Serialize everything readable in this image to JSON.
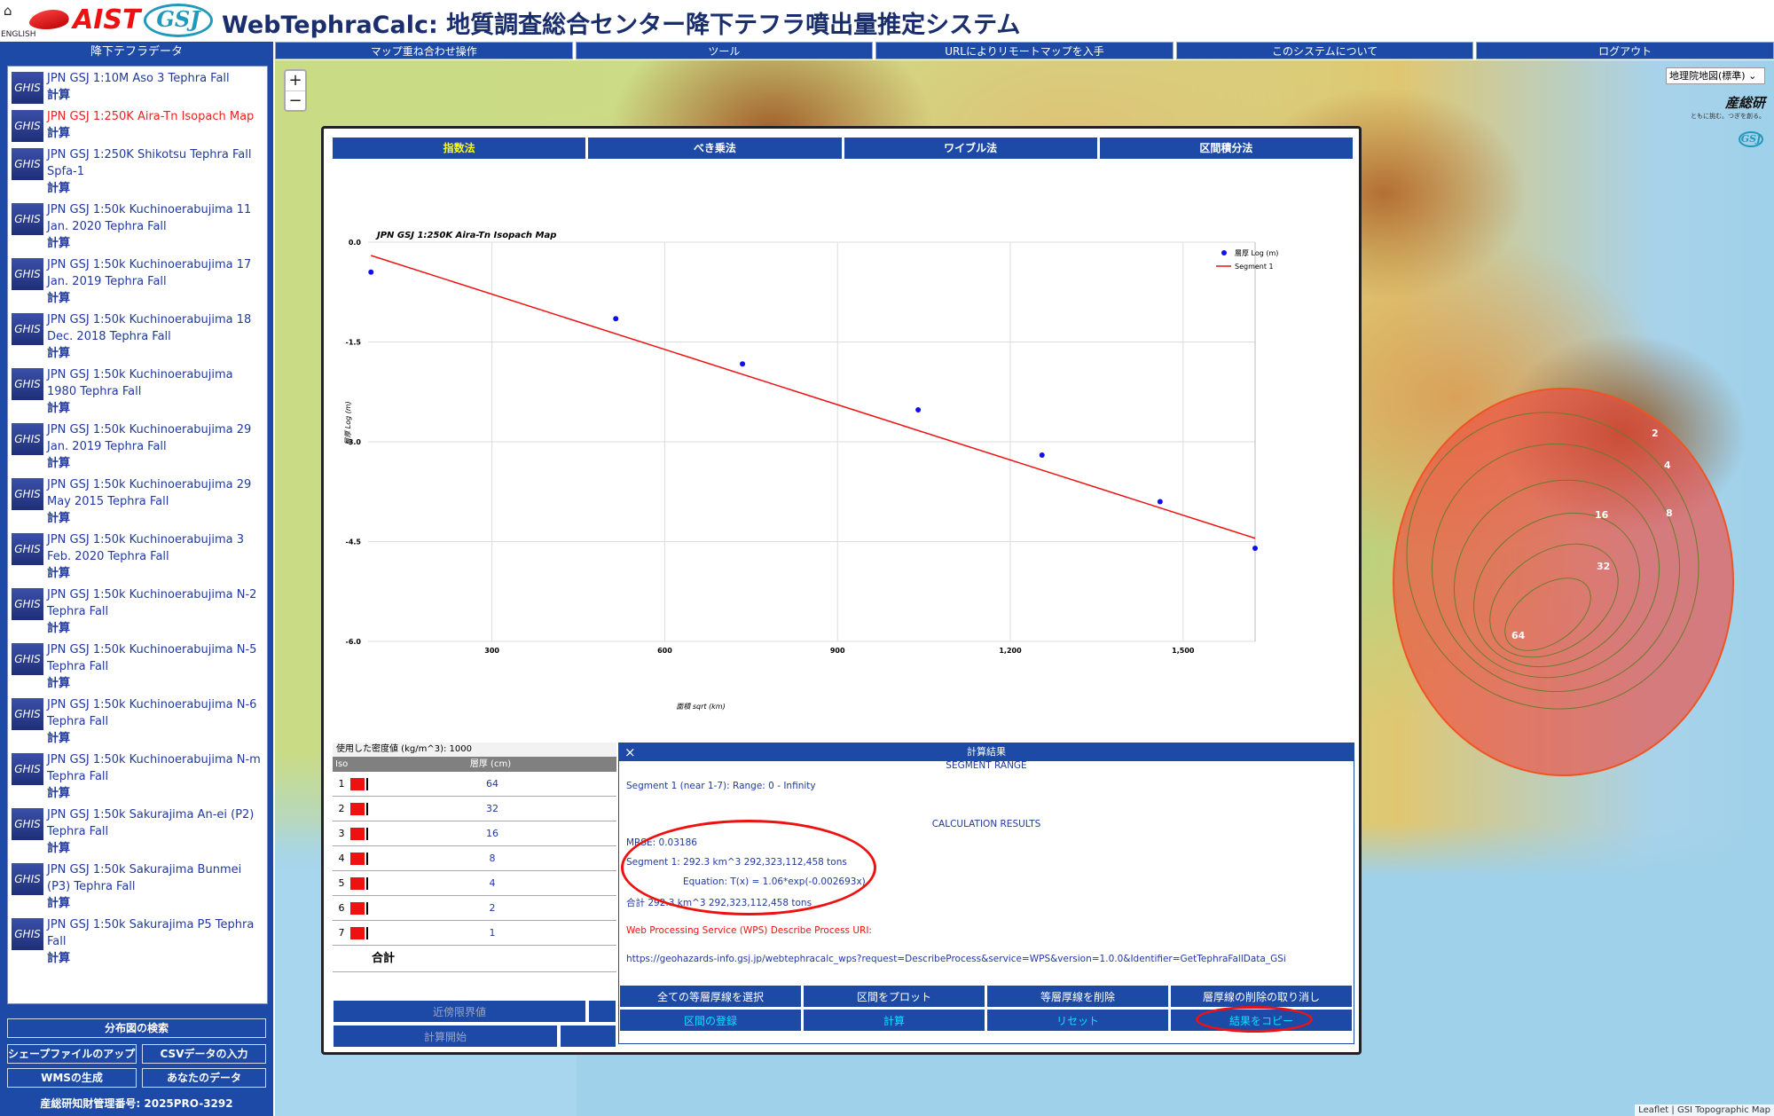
{
  "header": {
    "home_icon": "home-icon",
    "english": "ENGLISH",
    "aist_logo": "AIST",
    "gsj_logo": "GSJ",
    "title": "WebTephraCalc: 地質調査総合センター降下テフラ噴出量推定システム"
  },
  "sidebar": {
    "title": "降下テフラデータ",
    "badge": "GHIS",
    "calc_label": "計算",
    "items": [
      {
        "name": "JPN GSJ 1:10M Aso 3 Tephra Fall",
        "selected": false
      },
      {
        "name": "JPN GSJ 1:250K Aira-Tn Isopach Map",
        "selected": true
      },
      {
        "name": "JPN GSJ 1:250K Shikotsu Tephra Fall Spfa-1",
        "selected": false
      },
      {
        "name": "JPN GSJ 1:50k Kuchinoerabujima 11 Jan. 2020 Tephra Fall",
        "selected": false
      },
      {
        "name": "JPN GSJ 1:50k Kuchinoerabujima 17 Jan. 2019 Tephra Fall",
        "selected": false
      },
      {
        "name": "JPN GSJ 1:50k Kuchinoerabujima 18 Dec. 2018 Tephra Fall",
        "selected": false
      },
      {
        "name": "JPN GSJ 1:50k Kuchinoerabujima 1980 Tephra Fall",
        "selected": false
      },
      {
        "name": "JPN GSJ 1:50k Kuchinoerabujima 29 Jan. 2019 Tephra Fall",
        "selected": false
      },
      {
        "name": "JPN GSJ 1:50k Kuchinoerabujima 29 May 2015 Tephra Fall",
        "selected": false
      },
      {
        "name": "JPN GSJ 1:50k Kuchinoerabujima 3 Feb. 2020 Tephra Fall",
        "selected": false
      },
      {
        "name": "JPN GSJ 1:50k Kuchinoerabujima N-2 Tephra Fall",
        "selected": false
      },
      {
        "name": "JPN GSJ 1:50k Kuchinoerabujima N-5 Tephra Fall",
        "selected": false
      },
      {
        "name": "JPN GSJ 1:50k Kuchinoerabujima N-6 Tephra Fall",
        "selected": false
      },
      {
        "name": "JPN GSJ 1:50k Kuchinoerabujima N-m Tephra Fall",
        "selected": false
      },
      {
        "name": "JPN GSJ 1:50k Sakurajima An-ei (P2) Tephra Fall",
        "selected": false
      },
      {
        "name": "JPN GSJ 1:50k Sakurajima Bunmei (P3) Tephra Fall",
        "selected": false
      },
      {
        "name": "JPN GSJ 1:50k Sakurajima P5 Tephra Fall",
        "selected": false
      }
    ],
    "search_button": "分布図の検索",
    "shapefile_button": "シェープファイルのアップロード",
    "csv_button": "CSVデータの入力",
    "wms_button": "WMSの生成",
    "your_data_button": "あなたのデータ",
    "footer": "産総研知財管理番号: 2025PRO-3292"
  },
  "nav": [
    "マップ重ね合わせ操作",
    "ツール",
    "URLによりリモートマップを入手",
    "このシステムについて",
    "ログアウト"
  ],
  "map": {
    "zoom_in": "+",
    "zoom_out": "−",
    "map_type": "地理院地図(標準)",
    "aist_logo": "産総研",
    "aist_tagline": "ともに挑む。つぎを創る。",
    "gsj_logo": "GSJ",
    "contour_labels": [
      "2",
      "4",
      "8",
      "16",
      "32",
      "64"
    ],
    "attribution": "Leaflet | GSI Topographic Map"
  },
  "dialog": {
    "tabs": [
      {
        "label": "指数法",
        "active": true
      },
      {
        "label": "べき乗法",
        "active": false
      },
      {
        "label": "ワイブル法",
        "active": false
      },
      {
        "label": "区間積分法",
        "active": false
      }
    ],
    "table": {
      "density_label": "使用した密度値 (kg/m^3): 1000",
      "col_no": "Iso No.",
      "col_thickness": "層厚 (cm)",
      "rows": [
        {
          "no": "1",
          "thickness": "64"
        },
        {
          "no": "2",
          "thickness": "32"
        },
        {
          "no": "3",
          "thickness": "16"
        },
        {
          "no": "4",
          "thickness": "8"
        },
        {
          "no": "5",
          "thickness": "4"
        },
        {
          "no": "6",
          "thickness": "2"
        },
        {
          "no": "7",
          "thickness": "1"
        }
      ],
      "total_label": "合計",
      "near_limit_button": "近傍限界値",
      "start_calc_button": "計算開始"
    },
    "results": {
      "title": "計算結果",
      "close_icon": "×",
      "segment_range_heading": "SEGMENT RANGE",
      "segment_range": "Segment 1 (near 1-7): Range: 0  -  Infinity",
      "calc_heading": "CALCULATION RESULTS",
      "mrse": "MRSE: 0.03186",
      "segment1": "Segment 1:  292.3 km^3   292,323,112,458 tons",
      "equation": "Equation: T(x) = 1.06*exp(-0.002693x)",
      "total": "合計  292.3 km^3    292,323,112,458 tons",
      "wps_label": "Web Processing Service (WPS) Describe Process URI:",
      "wps_url": "https://geohazards-info.gsj.jp/webtephracalc_wps?request=DescribeProcess&service=WPS&version=1.0.0&Identifier=GetTephraFallData_GSi"
    },
    "buttons_row1": [
      "全ての等層厚線を選択",
      "区間をプロット",
      "等層厚線を削除",
      "層厚線の削除の取り消し"
    ],
    "buttons_row2": [
      "区間の登録",
      "計算",
      "リセット",
      "結果をコピー"
    ]
  },
  "chart_data": {
    "type": "scatter",
    "title": "JPN GSJ 1:250K Aira-Tn Isopach Map",
    "xlabel": "面積 sqrt (km)",
    "ylabel": "層厚 Log (m)",
    "xlim": [
      85,
      1625
    ],
    "ylim": [
      -6.0,
      0.0
    ],
    "xticks": [
      "300",
      "600",
      "900",
      "1,200",
      "1,500"
    ],
    "yticks": [
      "0.0",
      "-1.5",
      "-3.0",
      "-4.5",
      "-6.0"
    ],
    "series": [
      {
        "name": "層厚 Log (m)",
        "kind": "points",
        "color": "#1010ee",
        "x": [
          90,
          515,
          735,
          1040,
          1255,
          1460,
          1625
        ],
        "y": [
          -0.45,
          -1.15,
          -1.83,
          -2.52,
          -3.2,
          -3.9,
          -4.6
        ]
      },
      {
        "name": "Segment 1",
        "kind": "line",
        "color": "#ee1111",
        "x": [
          90,
          1625
        ],
        "y": [
          -0.2,
          -4.45
        ]
      }
    ],
    "legend": "top-right",
    "grid": true
  }
}
